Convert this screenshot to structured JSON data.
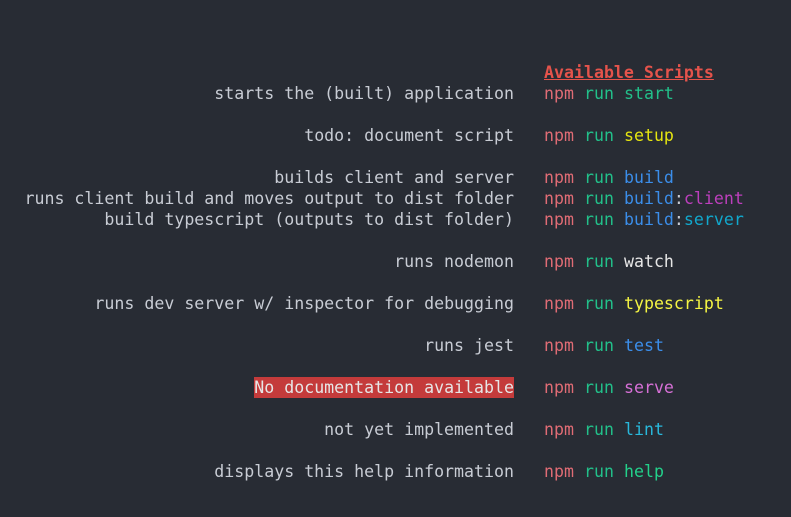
{
  "heading": "Available Scripts",
  "colors": {
    "background": "#282c34",
    "heading": "#e5534b",
    "npm": "#e06c75",
    "run": "#22c08a",
    "warning_bg": "#c43b3b"
  },
  "scripts": [
    {
      "description": "starts the (built) application",
      "npm": "npm",
      "run": "run",
      "name": "start",
      "name_color": "#22c08a"
    },
    {
      "description": "todo: document script",
      "npm": "npm",
      "run": "run",
      "name": "setup",
      "name_color": "#e5e510"
    },
    {
      "description": "builds client and server",
      "npm": "npm",
      "run": "run",
      "name": "build",
      "name_color": "#3b8eea"
    },
    {
      "description": "runs client build and moves output to dist folder",
      "npm": "npm",
      "run": "run",
      "name_base": "build",
      "sep": ":",
      "name_sub": "client",
      "base_color": "#3b8eea",
      "sub_color": "#bc3fbc"
    },
    {
      "description": "build typescript (outputs to dist folder)",
      "npm": "npm",
      "run": "run",
      "name_base": "build",
      "sep": ":",
      "name_sub": "server",
      "base_color": "#3b8eea",
      "sub_color": "#11a8cd"
    },
    {
      "description": "runs nodemon",
      "npm": "npm",
      "run": "run",
      "name": "watch",
      "name_color": "#e6e6e6"
    },
    {
      "description": "runs dev server w/ inspector for debugging",
      "npm": "npm",
      "run": "run",
      "name": "typescript",
      "name_color": "#f5f543"
    },
    {
      "description": "runs jest",
      "npm": "npm",
      "run": "run",
      "name": "test",
      "name_color": "#3b8eea"
    },
    {
      "description": "No documentation available",
      "warning": true,
      "npm": "npm",
      "run": "run",
      "name": "serve",
      "name_color": "#d670d6"
    },
    {
      "description": "not yet implemented",
      "npm": "npm",
      "run": "run",
      "name": "lint",
      "name_color": "#29b8db"
    },
    {
      "description": "displays this help information",
      "npm": "npm",
      "run": "run",
      "name": "help",
      "name_color": "#23d18b"
    }
  ]
}
